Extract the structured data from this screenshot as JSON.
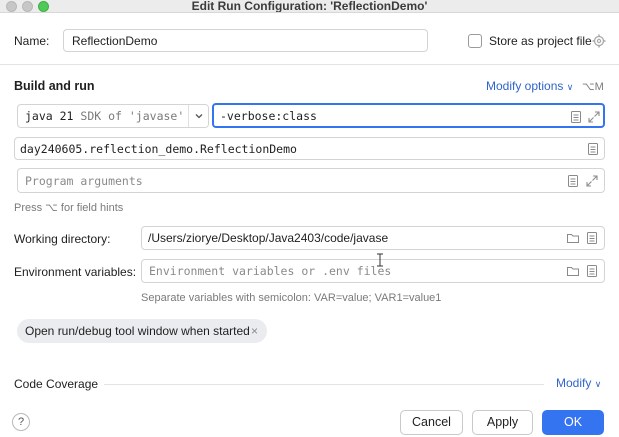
{
  "window": {
    "title": "Edit Run Configuration: 'ReflectionDemo'"
  },
  "name_row": {
    "label": "Name:",
    "value": "ReflectionDemo",
    "store_label": "Store as project file",
    "store_checked": false
  },
  "build": {
    "section_title": "Build and run",
    "modify_options": "Modify options",
    "modify_shortcut": "⌥M",
    "jdk_name": "java 21",
    "jdk_desc": "SDK of 'javase' m",
    "vm_options": "-verbose:class",
    "main_class": "day240605.reflection_demo.ReflectionDemo",
    "program_args_placeholder": "Program arguments",
    "field_hint": "Press ⌥ for field hints"
  },
  "working_dir": {
    "label": "Working directory:",
    "value": "/Users/ziorye/Desktop/Java2403/code/javase"
  },
  "env": {
    "label": "Environment variables:",
    "placeholder": "Environment variables or .env files",
    "hint": "Separate variables with semicolon: VAR=value; VAR1=value1"
  },
  "chip": {
    "label": "Open run/debug tool window when started",
    "close": "×"
  },
  "coverage": {
    "label": "Code Coverage",
    "modify": "Modify"
  },
  "footer": {
    "help": "?",
    "cancel": "Cancel",
    "apply": "Apply",
    "ok": "OK"
  },
  "colors": {
    "accent": "#3574f0",
    "link": "#2f65c9"
  }
}
